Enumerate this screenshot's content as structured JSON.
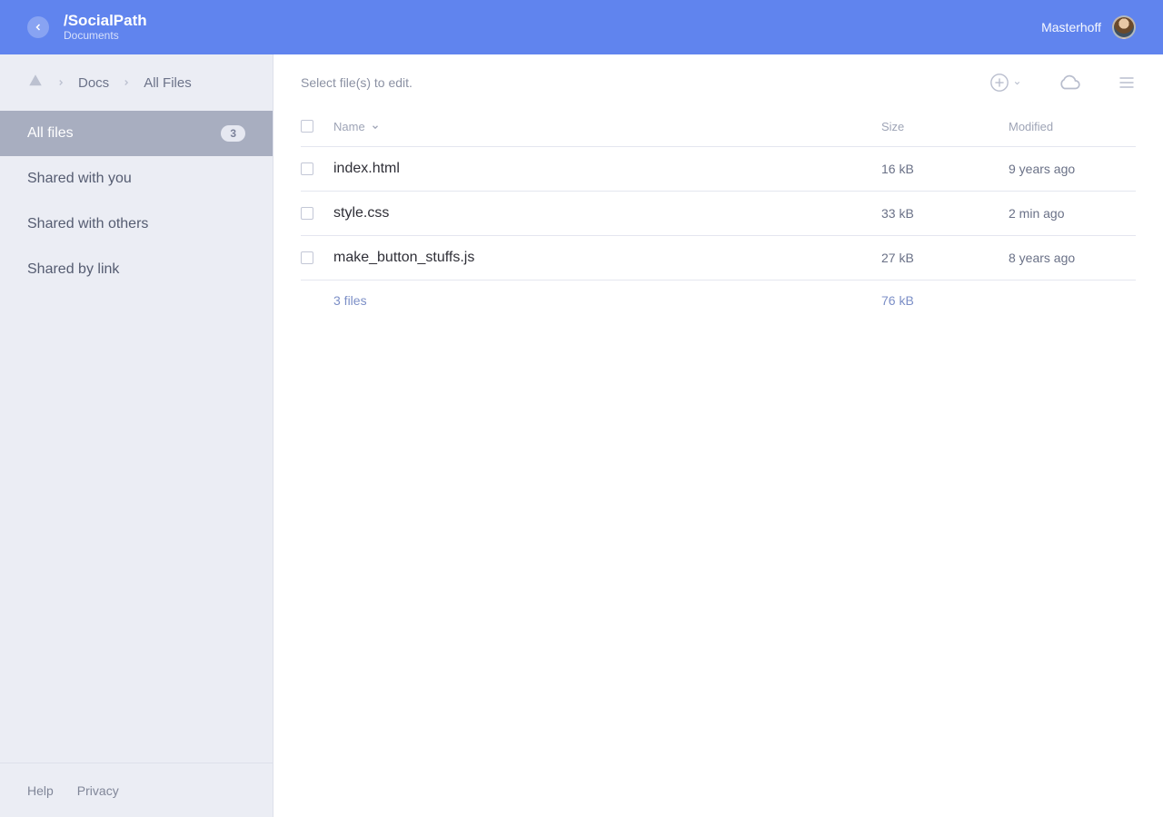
{
  "header": {
    "title": "/SocialPath",
    "subtitle": "Documents",
    "username": "Masterhoff"
  },
  "breadcrumb": {
    "items": [
      "Docs",
      "All Files"
    ]
  },
  "sidebar": {
    "items": [
      {
        "label": "All files",
        "badge": "3",
        "active": true
      },
      {
        "label": "Shared with you"
      },
      {
        "label": "Shared with others"
      },
      {
        "label": "Shared by link"
      }
    ],
    "footer": {
      "help": "Help",
      "privacy": "Privacy"
    }
  },
  "main": {
    "prompt": "Select file(s) to edit.",
    "columns": {
      "name": "Name",
      "size": "Size",
      "modified": "Modified"
    },
    "files": [
      {
        "name": "index.html",
        "size": "16 kB",
        "modified": "9 years ago"
      },
      {
        "name": "style.css",
        "size": "33 kB",
        "modified": "2 min ago"
      },
      {
        "name": "make_button_stuffs.js",
        "size": "27 kB",
        "modified": "8 years ago"
      }
    ],
    "summary": {
      "count": "3 files",
      "total_size": "76 kB"
    }
  }
}
